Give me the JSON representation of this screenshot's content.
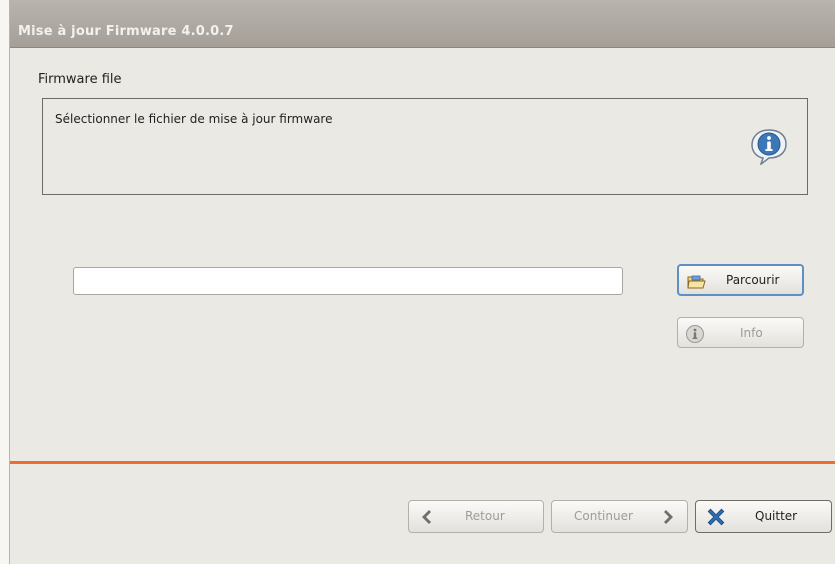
{
  "window": {
    "title": "Mise à jour Firmware 4.0.0.7"
  },
  "section": {
    "label": "Firmware file",
    "description": "Sélectionner le fichier de mise à jour firmware",
    "icon": "info-icon"
  },
  "file_input": {
    "value": "",
    "placeholder": ""
  },
  "buttons": {
    "browse": {
      "label": "Parcourir",
      "icon": "folder-icon",
      "enabled": true
    },
    "info": {
      "label": "Info",
      "icon": "info-icon",
      "enabled": false
    }
  },
  "footer": {
    "back": {
      "label": "Retour",
      "icon": "chevron-left-icon",
      "enabled": false
    },
    "next": {
      "label": "Continuer",
      "icon": "chevron-right-icon",
      "enabled": false
    },
    "quit": {
      "label": "Quitter",
      "icon": "close-icon",
      "enabled": true
    }
  },
  "colors": {
    "separator": "#ee6b32",
    "focus_border": "#5e8fc7",
    "icon_blue": "#2f6db3"
  }
}
